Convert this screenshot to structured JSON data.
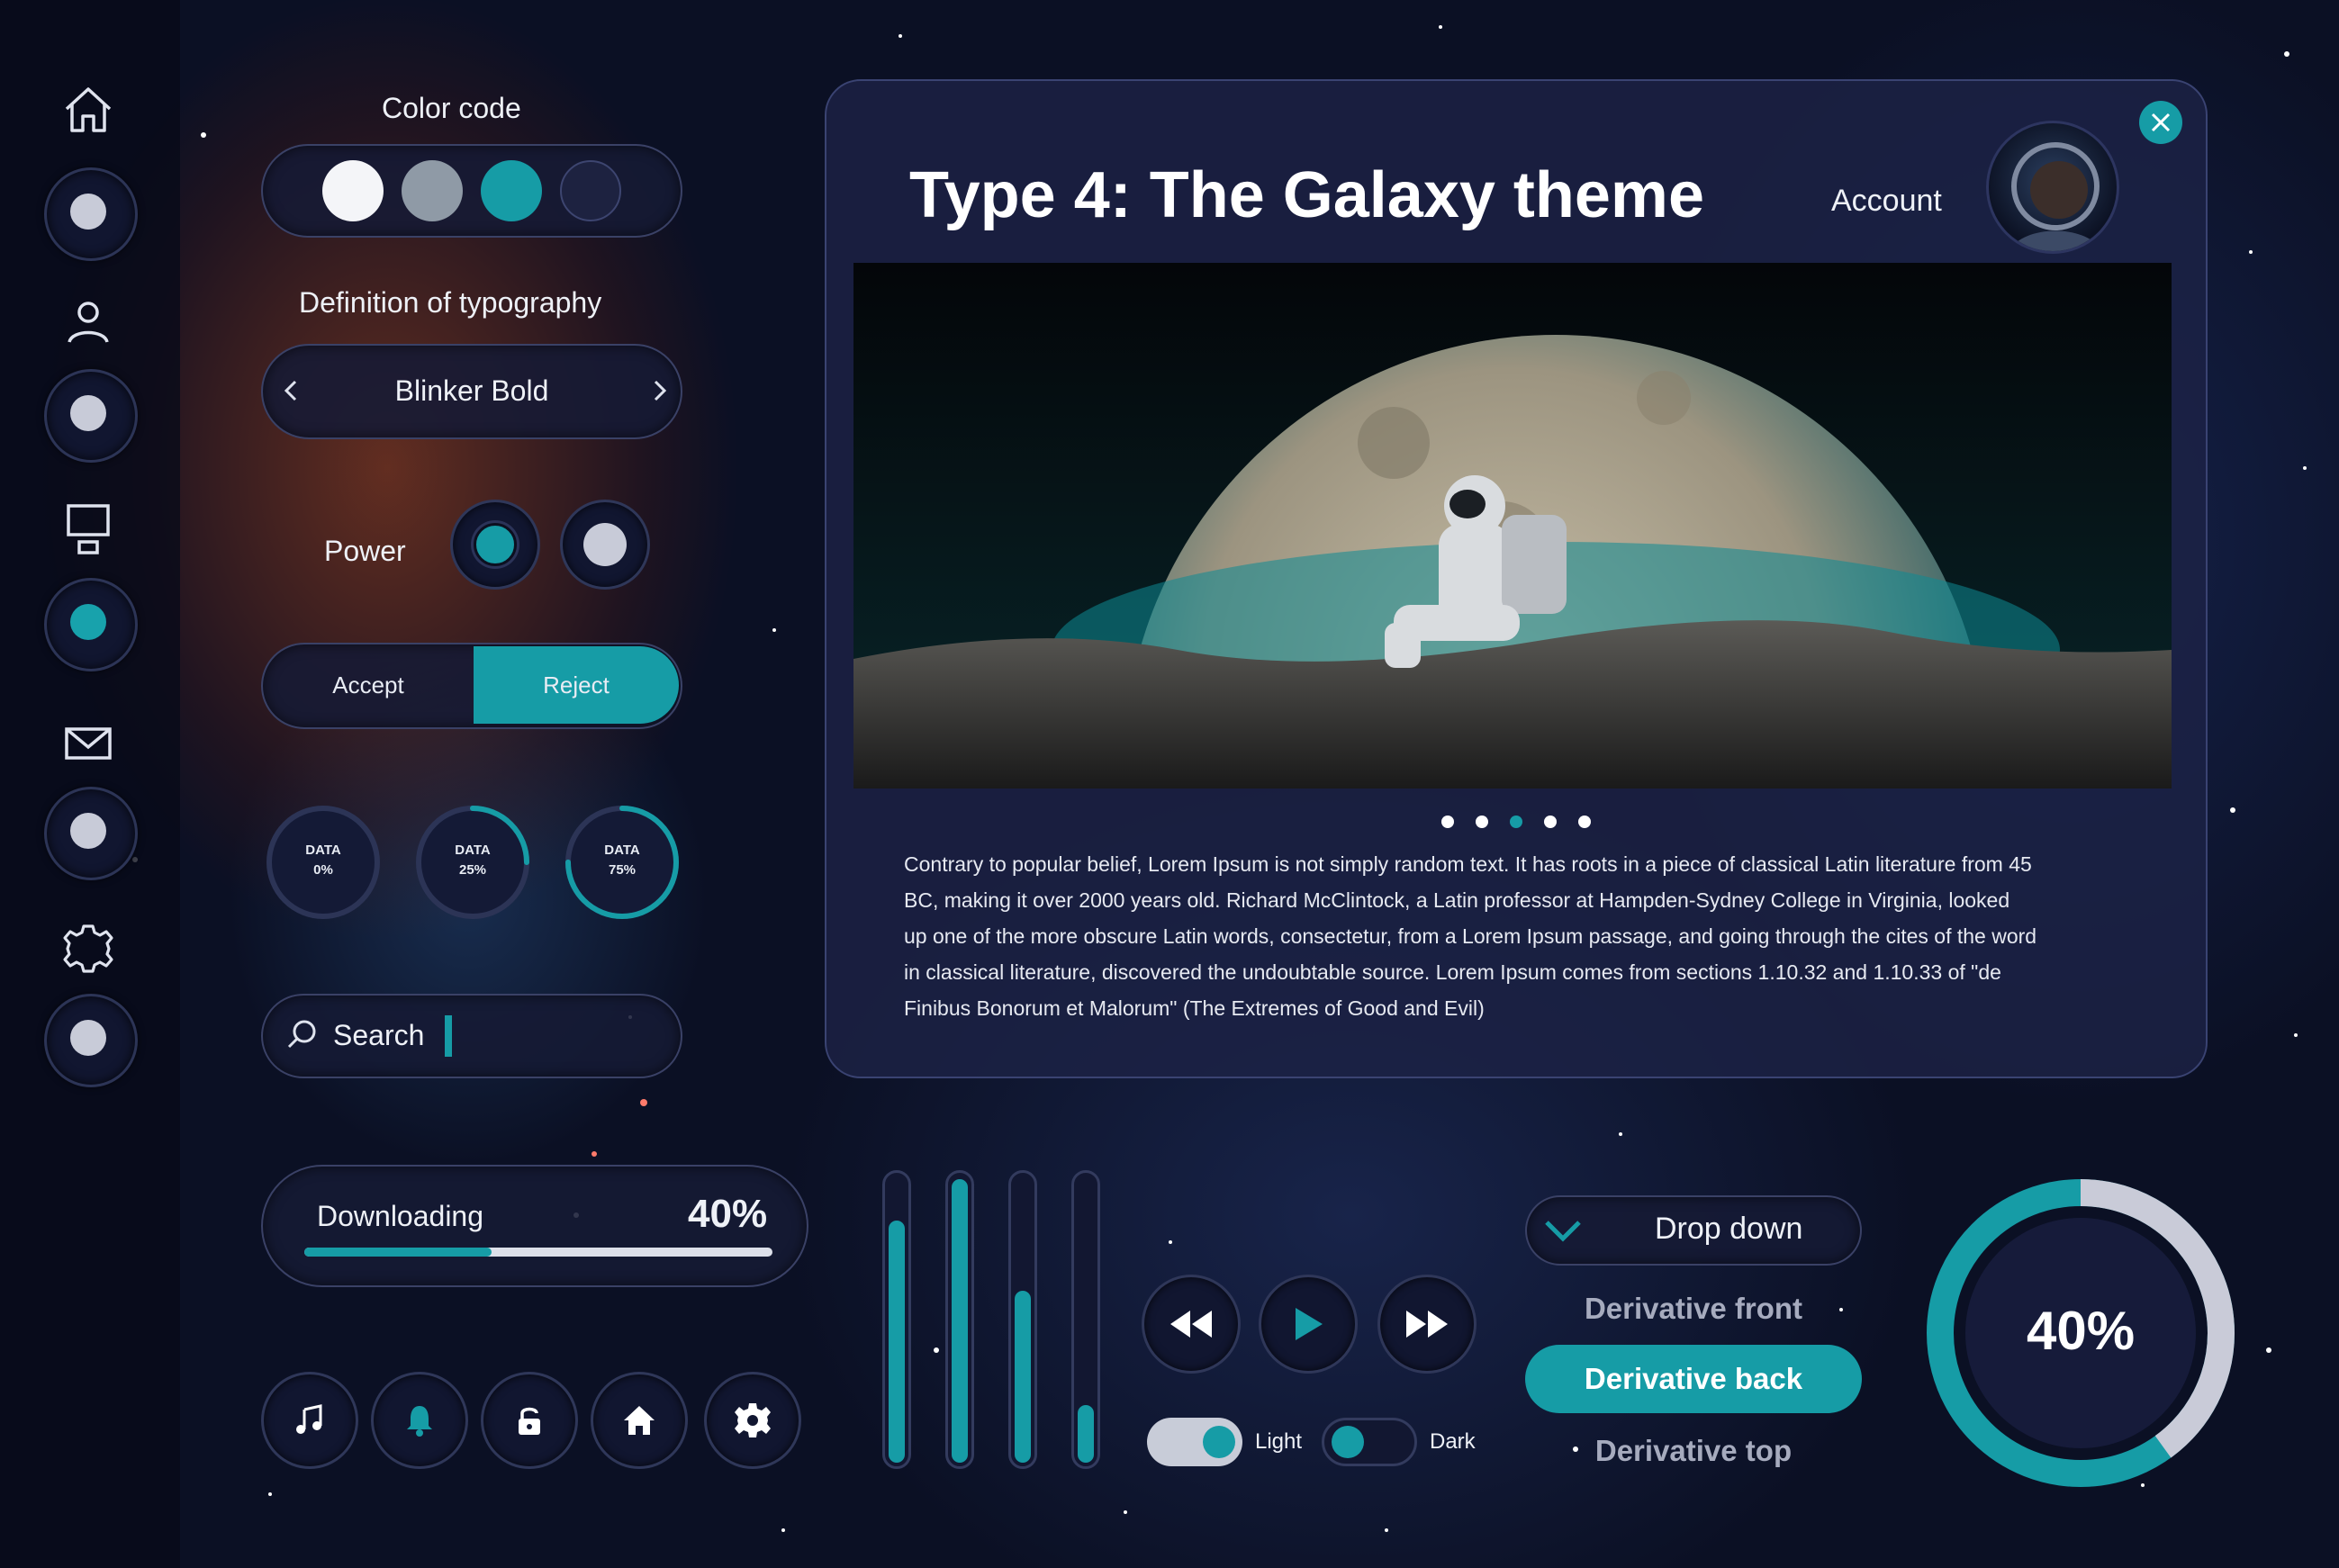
{
  "colors": {
    "accent": "#169ca6",
    "swatches": [
      "#f4f5f8",
      "#8f9aa6",
      "#169ca6",
      "#1d2240"
    ]
  },
  "sidebar": {
    "icons": [
      "home-icon",
      "user-icon",
      "monitor-icon",
      "mail-icon",
      "gear-icon"
    ]
  },
  "color_code": {
    "label": "Color code"
  },
  "typography": {
    "label": "Definition of typography",
    "font": "Blinker Bold"
  },
  "power": {
    "label": "Power"
  },
  "segmented": {
    "accept": "Accept",
    "reject": "Reject"
  },
  "data_rings": [
    {
      "title": "DATA",
      "value": "0%",
      "fraction": 0
    },
    {
      "title": "DATA",
      "value": "25%",
      "fraction": 0.25
    },
    {
      "title": "DATA",
      "value": "75%",
      "fraction": 0.75
    }
  ],
  "search": {
    "placeholder": "Search"
  },
  "download": {
    "label": "Downloading",
    "percent_text": "40%",
    "fraction": 0.4
  },
  "bottom_icons": [
    "music-icon",
    "bell-icon",
    "lock-icon",
    "home-icon",
    "gear-icon"
  ],
  "panel": {
    "title": "Type 4: The Galaxy theme",
    "account": "Account",
    "carousel": {
      "count": 5,
      "active": 2
    },
    "body": "Contrary to popular belief, Lorem Ipsum is not simply random text. It has roots in a piece of classical Latin literature from 45 BC, making it over 2000 years old. Richard McClintock, a Latin professor at Hampden-Sydney College in Virginia, looked up one of the more obscure Latin words, consectetur, from a Lorem Ipsum passage, and going through the cites of the word in classical literature, discovered the undoubtable source. Lorem Ipsum comes from sections 1.10.32 and 1.10.33 of \"de Finibus Bonorum et Malorum\" (The Extremes of Good and Evil)"
  },
  "sliders": [
    0.85,
    0.99,
    0.61,
    0.22
  ],
  "player": {
    "prev": "rewind-icon",
    "play": "play-icon",
    "next": "fast-forward-icon"
  },
  "toggles": {
    "light": "Light",
    "dark": "Dark"
  },
  "dropdown": {
    "label": "Drop down",
    "items": [
      "Derivative front",
      "Derivative back",
      "Derivative top"
    ],
    "selected": 1
  },
  "big_gauge": {
    "text": "40%",
    "fraction": 0.4
  }
}
